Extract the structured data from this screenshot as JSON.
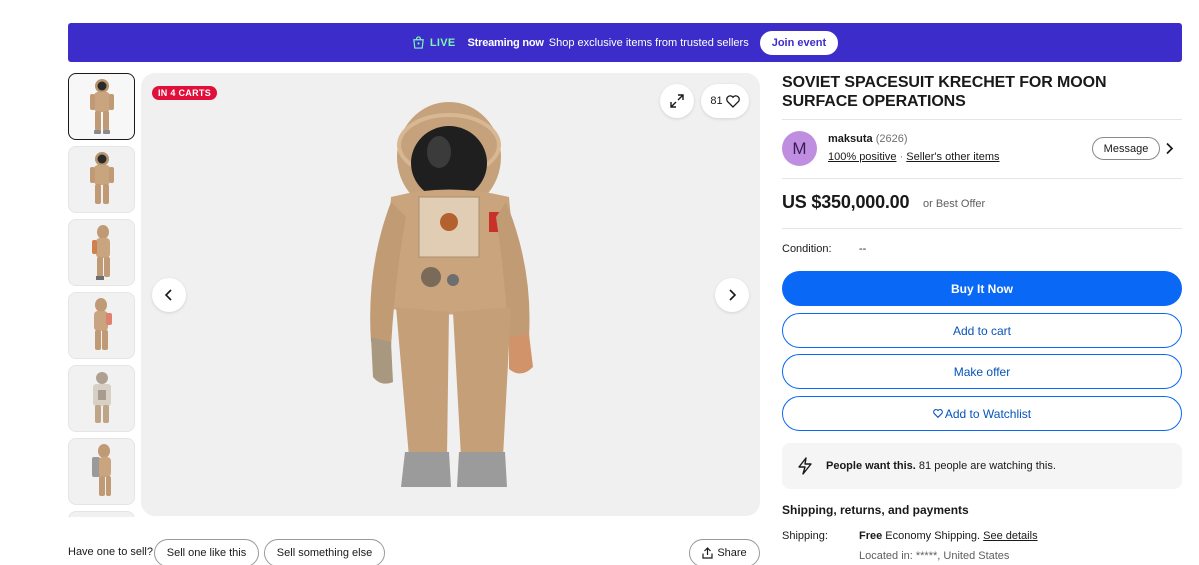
{
  "banner": {
    "live_label": "LIVE",
    "streaming_label": "Streaming now",
    "message": "Shop exclusive items from trusted sellers",
    "join_label": "Join event",
    "color": "#3c2cc9",
    "live_color": "#7cf5b8"
  },
  "gallery": {
    "badge": "IN 4 CARTS",
    "watch_count": "81",
    "thumbnail_count": 7,
    "icons": [
      "expand-icon",
      "heart-icon",
      "chevron-left-icon",
      "chevron-right-icon"
    ]
  },
  "sell_row": {
    "prompt": "Have one to sell?",
    "sell_like": "Sell one like this",
    "sell_else": "Sell something else",
    "share": "Share"
  },
  "listing": {
    "title": "SOVIET SPACESUIT KRECHET FOR MOON SURFACE OPERATIONS",
    "seller": {
      "initial": "M",
      "name": "maksuta",
      "feedback_count": "(2626)",
      "positive": "100% positive",
      "separator": "·",
      "other_items": "Seller's other items",
      "message_label": "Message"
    },
    "price": "US $350,000.00",
    "best_offer": "or Best Offer",
    "condition_label": "Condition:",
    "condition_value": "--",
    "buttons": {
      "buy_now": "Buy It Now",
      "add_cart": "Add to cart",
      "make_offer": "Make offer",
      "watchlist": "Add to Watchlist"
    },
    "people_want": {
      "bold": "People want this.",
      "rest": " 81 people are watching this."
    },
    "shipping": {
      "heading": "Shipping, returns, and payments",
      "label": "Shipping:",
      "free": "Free",
      "method": " Economy Shipping. ",
      "details_link": "See details",
      "location": "Located in: *****, United States"
    },
    "accent_color": "#0968f6"
  }
}
